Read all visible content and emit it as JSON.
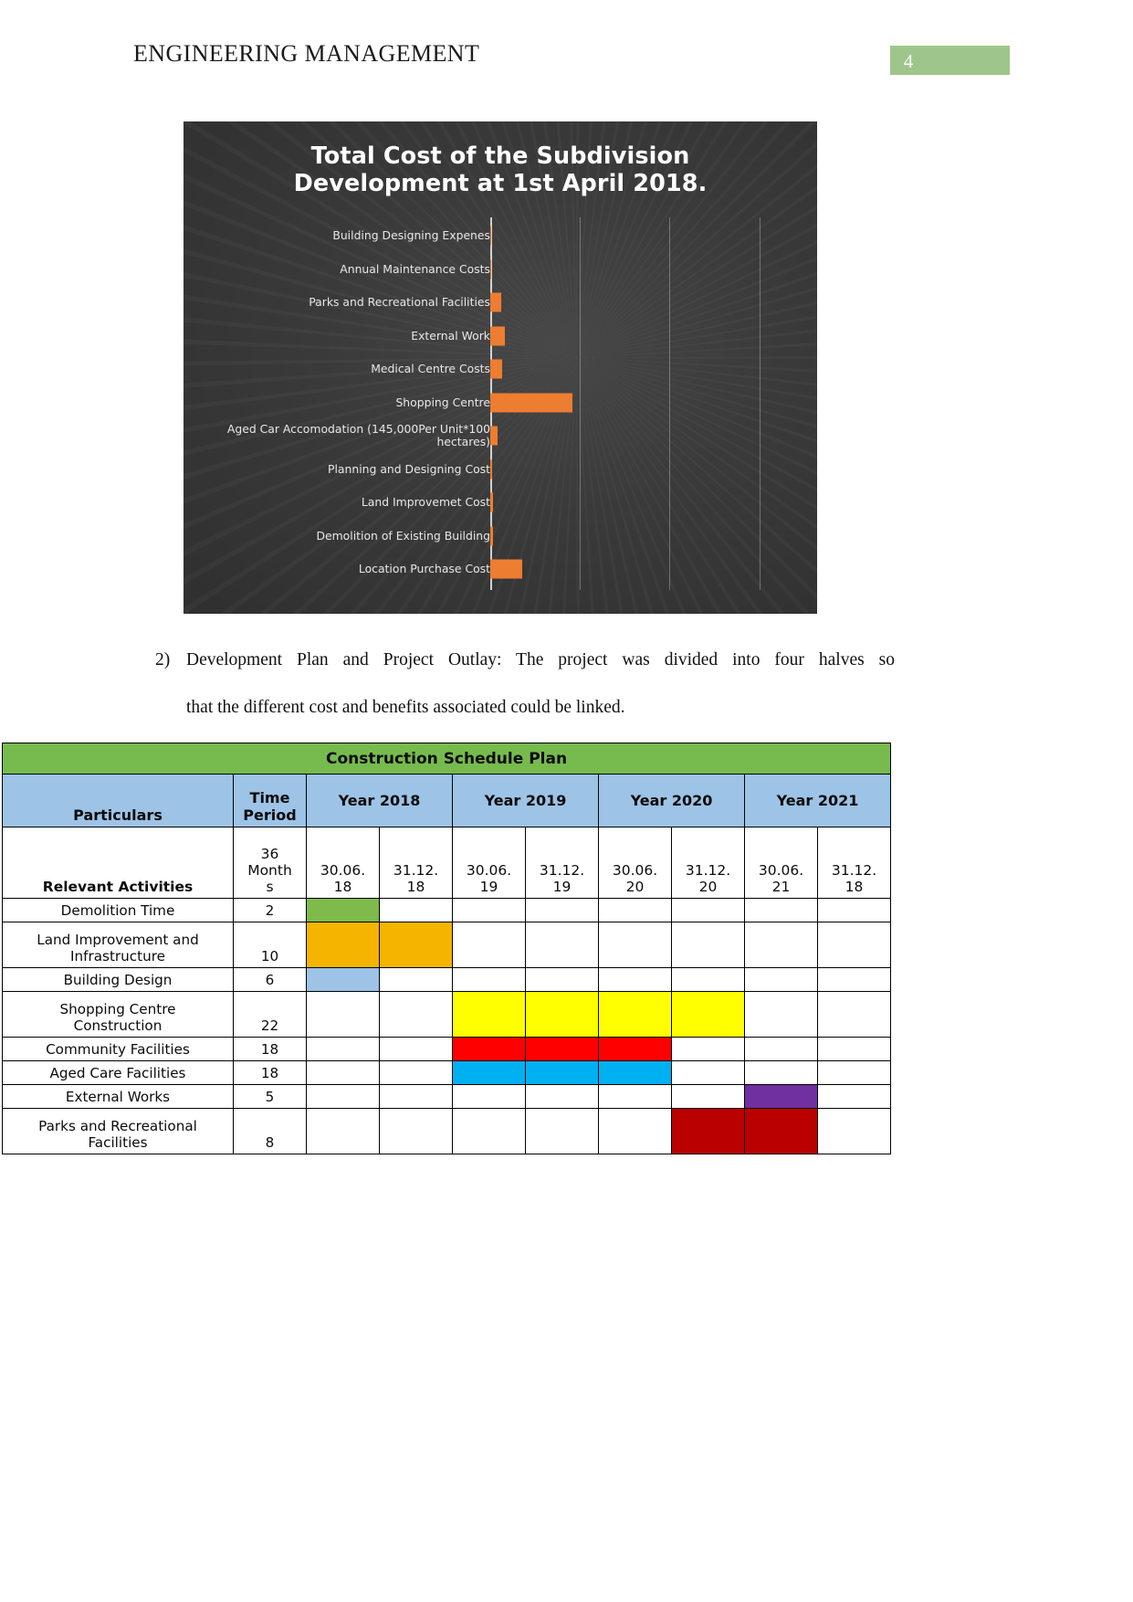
{
  "header": {
    "title": "ENGINEERING MANAGEMENT",
    "page_number": "4",
    "accent_color": "#9fc68a"
  },
  "chart_data": {
    "type": "bar",
    "orientation": "horizontal",
    "title": "Total Cost of the Subdivision Development at 1st April 2018.",
    "title_line1": "Total Cost of the Subdivision",
    "title_line2": "Development at 1st April 2018.",
    "xlabel": "",
    "ylabel": "",
    "xlim": [
      0,
      330000000
    ],
    "xticks": [
      "0",
      "100000000",
      "200000000",
      "300000000"
    ],
    "xtick_values": [
      0,
      100000000,
      200000000,
      300000000
    ],
    "grid": true,
    "legend": "none",
    "bar_color": "#ed7d31",
    "background_color": "#3b3b3b",
    "text_color": "#e8e8e8",
    "categories": [
      "Building Designing Expenes",
      "Annual Maintenance Costs",
      "Parks and Recreational Facilities",
      "External Work",
      "Medical Centre Costs",
      "Shopping Centre",
      "Aged Car Accomodation (145,000Per Unit*100 hectares)",
      "Planning and Designing Cost",
      "Land Improvemet Cost",
      "Demolition of Existing Building",
      "Location Purchase Cost"
    ],
    "values": [
      1000000,
      500000,
      12000000,
      16000000,
      13000000,
      92000000,
      8000000,
      2000000,
      3000000,
      3000000,
      36000000
    ]
  },
  "body": {
    "item_marker": "2)",
    "line1": "Development Plan and Project Outlay: The project was divided into four halves so",
    "line2": "that the different cost and benefits associated could be linked."
  },
  "table": {
    "title": "Construction Schedule Plan",
    "title_color": "#77bb4e",
    "header_color": "#9dc3e6",
    "headers": {
      "particulars": "Particulars",
      "time_period_l1": "Time",
      "time_period_l2": "Period",
      "years": [
        "Year 2018",
        "Year 2019",
        "Year 2020",
        "Year 2021"
      ]
    },
    "subheader": {
      "activities_label": "Relevant Activities",
      "time_period_l1": "36",
      "time_period_l2": "Month",
      "time_period_l3": "s",
      "dates": [
        {
          "l1": "30.06.",
          "l2": "18"
        },
        {
          "l1": "31.12.",
          "l2": "18"
        },
        {
          "l1": "30.06.",
          "l2": "19"
        },
        {
          "l1": "31.12.",
          "l2": "19"
        },
        {
          "l1": "30.06.",
          "l2": "20"
        },
        {
          "l1": "31.12.",
          "l2": "20"
        },
        {
          "l1": "30.06.",
          "l2": "21"
        },
        {
          "l1": "31.12.",
          "l2": "18"
        }
      ]
    },
    "rows": [
      {
        "activity": "Demolition Time",
        "activity_l1": "Demolition Time",
        "activity_l2": "",
        "time_period": "2",
        "bars": [
          {
            "start": 0,
            "span": 1,
            "color": "#7fba4c"
          }
        ],
        "tall": false
      },
      {
        "activity": "Land Improvement and Infrastructure",
        "activity_l1": "Land Improvement and",
        "activity_l2": "Infrastructure",
        "time_period": "10",
        "bars": [
          {
            "start": 0,
            "span": 2,
            "color": "#f5b400"
          }
        ],
        "tall": true
      },
      {
        "activity": "Building Design",
        "activity_l1": "Building Design",
        "activity_l2": "",
        "time_period": "6",
        "bars": [
          {
            "start": 0,
            "span": 1,
            "color": "#9dc3e6"
          }
        ],
        "tall": false
      },
      {
        "activity": "Shopping Centre Construction",
        "activity_l1": "Shopping Centre",
        "activity_l2": "Construction",
        "time_period": "22",
        "bars": [
          {
            "start": 2,
            "span": 4,
            "color": "#ffff00"
          }
        ],
        "tall": true
      },
      {
        "activity": "Community Facilities",
        "activity_l1": "Community Facilities",
        "activity_l2": "",
        "time_period": "18",
        "bars": [
          {
            "start": 2,
            "span": 3,
            "color": "#fe0000"
          }
        ],
        "tall": false
      },
      {
        "activity": "Aged Care Facilities",
        "activity_l1": "Aged Care Facilities",
        "activity_l2": "",
        "time_period": "18",
        "bars": [
          {
            "start": 2,
            "span": 3,
            "color": "#00b0f0"
          }
        ],
        "tall": false
      },
      {
        "activity": "External Works",
        "activity_l1": "External Works",
        "activity_l2": "",
        "time_period": "5",
        "bars": [
          {
            "start": 6,
            "span": 1,
            "color": "#7030a0"
          }
        ],
        "tall": false
      },
      {
        "activity": "Parks and Recreational Facilities",
        "activity_l1": "Parks and Recreational",
        "activity_l2": "Facilities",
        "time_period": "8",
        "bars": [
          {
            "start": 5,
            "span": 2,
            "color": "#bb0000"
          }
        ],
        "tall": true
      }
    ]
  }
}
